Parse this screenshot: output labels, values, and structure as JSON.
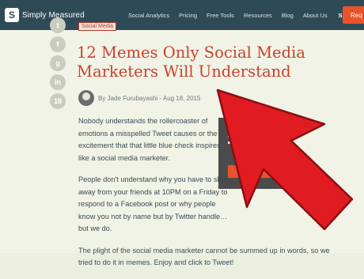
{
  "header": {
    "logo_text": "Simply Measured",
    "nav": [
      "Social Analytics",
      "Pricing",
      "Free Tools",
      "Resources",
      "Blog",
      "About Us"
    ],
    "signin": "Sign In",
    "cta": "Req"
  },
  "share": {
    "icons": [
      "twitter-icon",
      "facebook-icon",
      "google-plus-icon",
      "linkedin-icon",
      "count-icon"
    ],
    "count": "18"
  },
  "article": {
    "tag": "Social Media",
    "title": "12 Memes Only Social Media Marketers Will Understand",
    "by": "By",
    "author": "Jade Furubayashi",
    "date": "- Aug 18, 2015",
    "p1": "Nobody understands the rollercoaster of emotions a misspelled Tweet causes or the excitement that that little blue check inspires like a social media marketer.",
    "p2": "People don't understand why you have to slink away from your friends at 10PM on a Friday to respond to a Facebook post or why people know you not by name but by Twitter handle…but we do.",
    "p3": "The plight of the social media marketer cannot be summed up in words, so we tried to do it in memes. Enjoy and click to Tweet!"
  },
  "colors": {
    "header_bg": "#2f4a57",
    "title": "#c8412e",
    "arrow": "#e01b22",
    "cta": "#e8532b"
  }
}
